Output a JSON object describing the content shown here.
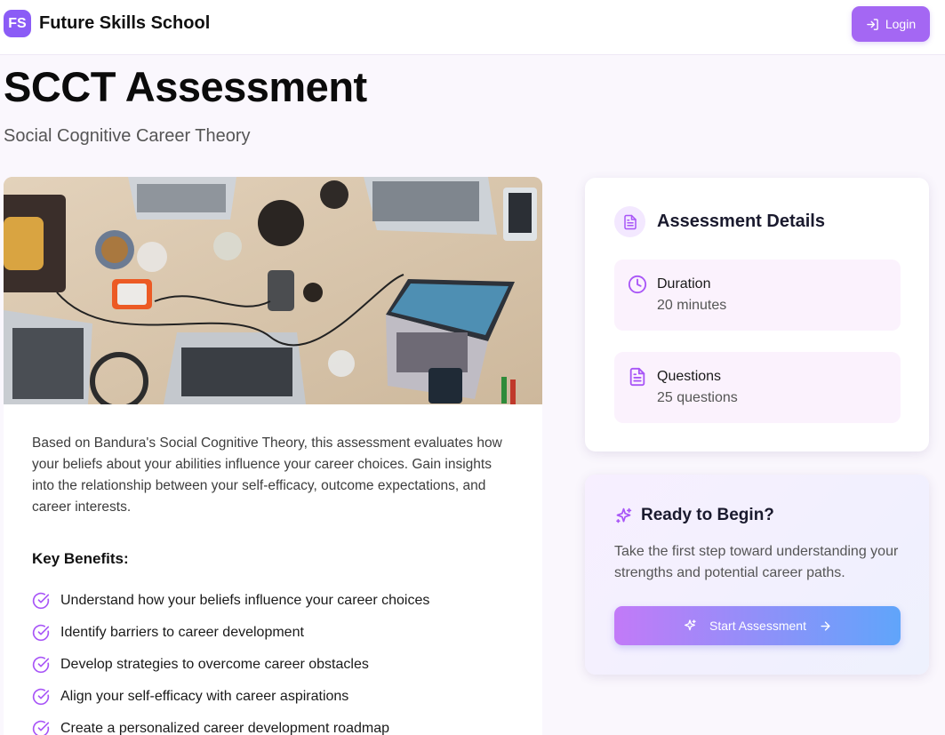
{
  "brand": {
    "logo": "FS",
    "name": "Future Skills School"
  },
  "nav": {
    "login_label": "Login",
    "login_icon": "login-arrow-icon"
  },
  "page": {
    "title": "SCCT Assessment",
    "subtitle": "Social Cognitive Career Theory"
  },
  "overview": {
    "image_icon": "laptops-desk-photo",
    "description": "Based on Bandura's Social Cognitive Theory, this assessment evaluates how your beliefs about your abilities influence your career choices. Gain insights into the relationship between your self-efficacy, outcome expectations, and career interests.",
    "benefits_title": "Key Benefits:",
    "benefits": [
      "Understand how your beliefs influence your career choices",
      "Identify barriers to career development",
      "Develop strategies to overcome career obstacles",
      "Align your self-efficacy with career aspirations",
      "Create a personalized career development roadmap"
    ]
  },
  "details": {
    "title": "Assessment Details",
    "duration_label": "Duration",
    "duration_value": "20 minutes",
    "questions_label": "Questions",
    "questions_value": "25 questions"
  },
  "begin": {
    "title": "Ready to Begin?",
    "text": "Take the first step toward understanding your strengths and potential career paths.",
    "button_label": "Start Assessment"
  },
  "colors": {
    "accent": "#a467f3",
    "icon": "#a855f7",
    "gradient_start": "#c27af8",
    "gradient_end": "#60a5fa"
  }
}
